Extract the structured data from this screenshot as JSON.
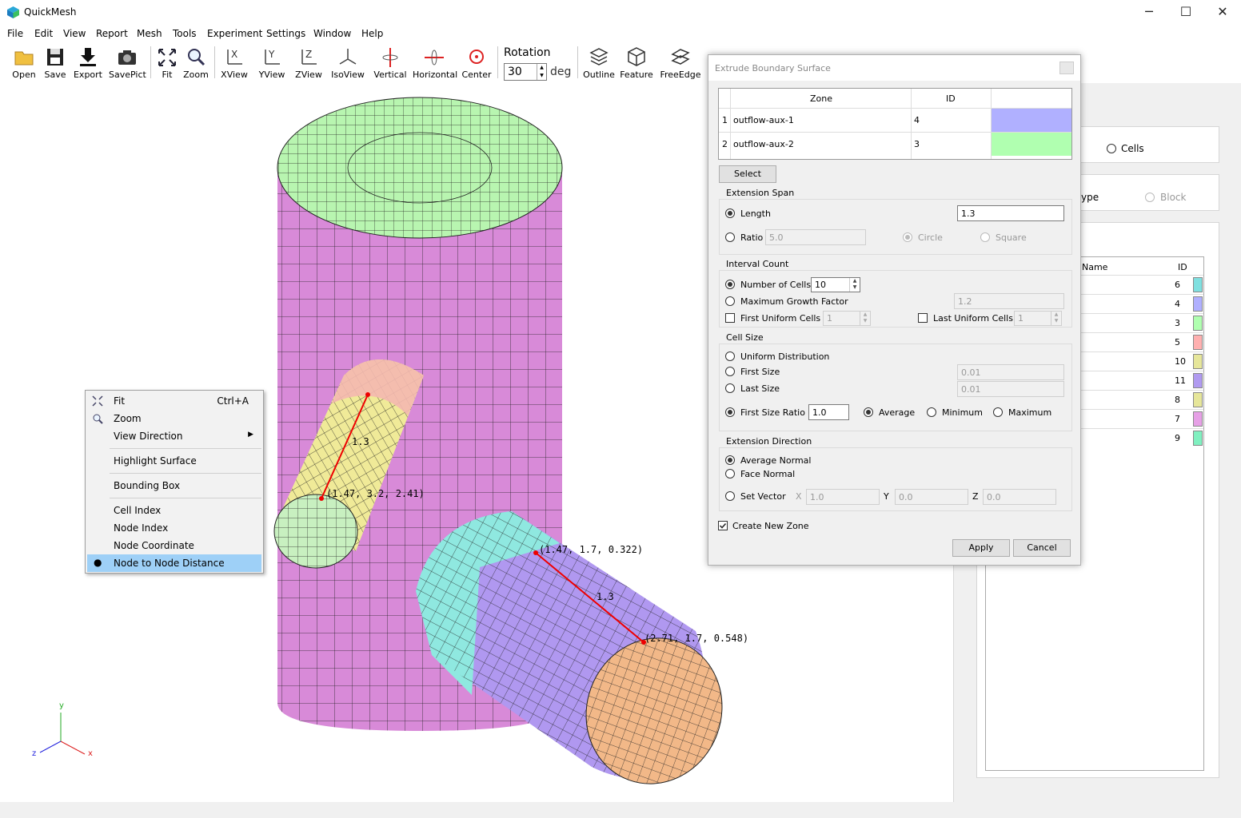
{
  "app": {
    "title": "QuickMesh"
  },
  "window_controls": {
    "minimize": "─",
    "maximize": "☐",
    "close": "✕"
  },
  "menu": [
    "File",
    "Edit",
    "View",
    "Report",
    "Mesh",
    "Tools",
    "Experiment",
    "Settings",
    "Window",
    "Help"
  ],
  "toolbar": {
    "buttons": [
      "Open",
      "Save",
      "Export",
      "SavePict",
      "Fit",
      "Zoom",
      "XView",
      "YView",
      "ZView",
      "IsoView",
      "Vertical",
      "Horizontal",
      "Center"
    ],
    "rotation_label": "Rotation",
    "rotation_value": "30",
    "rotation_unit": "deg",
    "buttons2": [
      "Outline",
      "Feature",
      "FreeEdge"
    ]
  },
  "viewport": {
    "measure1": {
      "label": "1.3",
      "coord": "(1.47, 3.2, 2.41)"
    },
    "measure2": {
      "label": "1.3",
      "coord_start": "(1.47, 1.7, 0.322)",
      "coord_end": "(2.71, 1.7, 0.548)"
    },
    "axes": {
      "x": "x",
      "y": "y",
      "z": "z"
    }
  },
  "context_menu": {
    "items": [
      {
        "label": "Fit",
        "shortcut": "Ctrl+A",
        "icon": "fit-icon"
      },
      {
        "label": "Zoom",
        "icon": "zoom-icon"
      },
      {
        "label": "View Direction",
        "submenu": true
      },
      {
        "label": "Highlight Surface"
      },
      {
        "label": "Bounding Box"
      },
      {
        "label": "Cell Index"
      },
      {
        "label": "Node Index"
      },
      {
        "label": "Node Coordinate"
      },
      {
        "label": "Node to Node Distance",
        "selected": true
      }
    ]
  },
  "right_panel": {
    "cells_label": "Cells",
    "type_label": "ype",
    "block_label": "Block",
    "table": {
      "headers": [
        "Name",
        "ID"
      ],
      "rows": [
        {
          "id": "6",
          "color": "#7fe0e0"
        },
        {
          "id": "4",
          "color": "#b0b0ff"
        },
        {
          "id": "3",
          "color": "#b0ffb0"
        },
        {
          "id": "5",
          "color": "#ffb0b0"
        },
        {
          "id": "10",
          "color": "#e6e69a"
        },
        {
          "id": "11",
          "color": "#b09af0"
        },
        {
          "id": "8",
          "color": "#e6e69a"
        },
        {
          "id": "7",
          "color": "#e6a0e6"
        },
        {
          "id": "9",
          "color": "#80f0c0"
        }
      ]
    }
  },
  "dialog": {
    "title": "Extrude Boundary Surface",
    "zone_table": {
      "headers": [
        "Zone",
        "ID"
      ],
      "rows": [
        {
          "num": "1",
          "zone": "outflow-aux-1",
          "id": "4",
          "color": "#b0b0ff"
        },
        {
          "num": "2",
          "zone": "outflow-aux-2",
          "id": "3",
          "color": "#b0ffb0"
        }
      ]
    },
    "select_btn": "Select",
    "extension_span": {
      "title": "Extension Span",
      "length_label": "Length",
      "length_value": "1.3",
      "ratio_label": "Ratio",
      "ratio_value": "5.0",
      "circle_label": "Circle",
      "square_label": "Square"
    },
    "interval_count": {
      "title": "Interval Count",
      "num_cells_label": "Number of Cells",
      "num_cells_value": "10",
      "max_growth_label": "Maximum Growth Factor",
      "max_growth_value": "1.2",
      "first_uniform_label": "First Uniform Cells",
      "first_uniform_value": "1",
      "last_uniform_label": "Last Uniform Cells",
      "last_uniform_value": "1"
    },
    "cell_size": {
      "title": "Cell Size",
      "uniform_label": "Uniform Distribution",
      "first_size_label": "First Size",
      "first_size_value": "0.01",
      "last_size_label": "Last Size",
      "last_size_value": "0.01",
      "first_ratio_label": "First Size Ratio",
      "first_ratio_value": "1.0",
      "average_label": "Average",
      "minimum_label": "Minimum",
      "maximum_label": "Maximum"
    },
    "extension_direction": {
      "title": "Extension Direction",
      "avg_normal_label": "Average Normal",
      "face_normal_label": "Face Normal",
      "set_vector_label": "Set Vector",
      "x_label": "X",
      "x_value": "1.0",
      "y_label": "Y",
      "y_value": "0.0",
      "z_label": "Z",
      "z_value": "0.0"
    },
    "create_zone_label": "Create New Zone",
    "apply_btn": "Apply",
    "cancel_btn": "Cancel"
  }
}
